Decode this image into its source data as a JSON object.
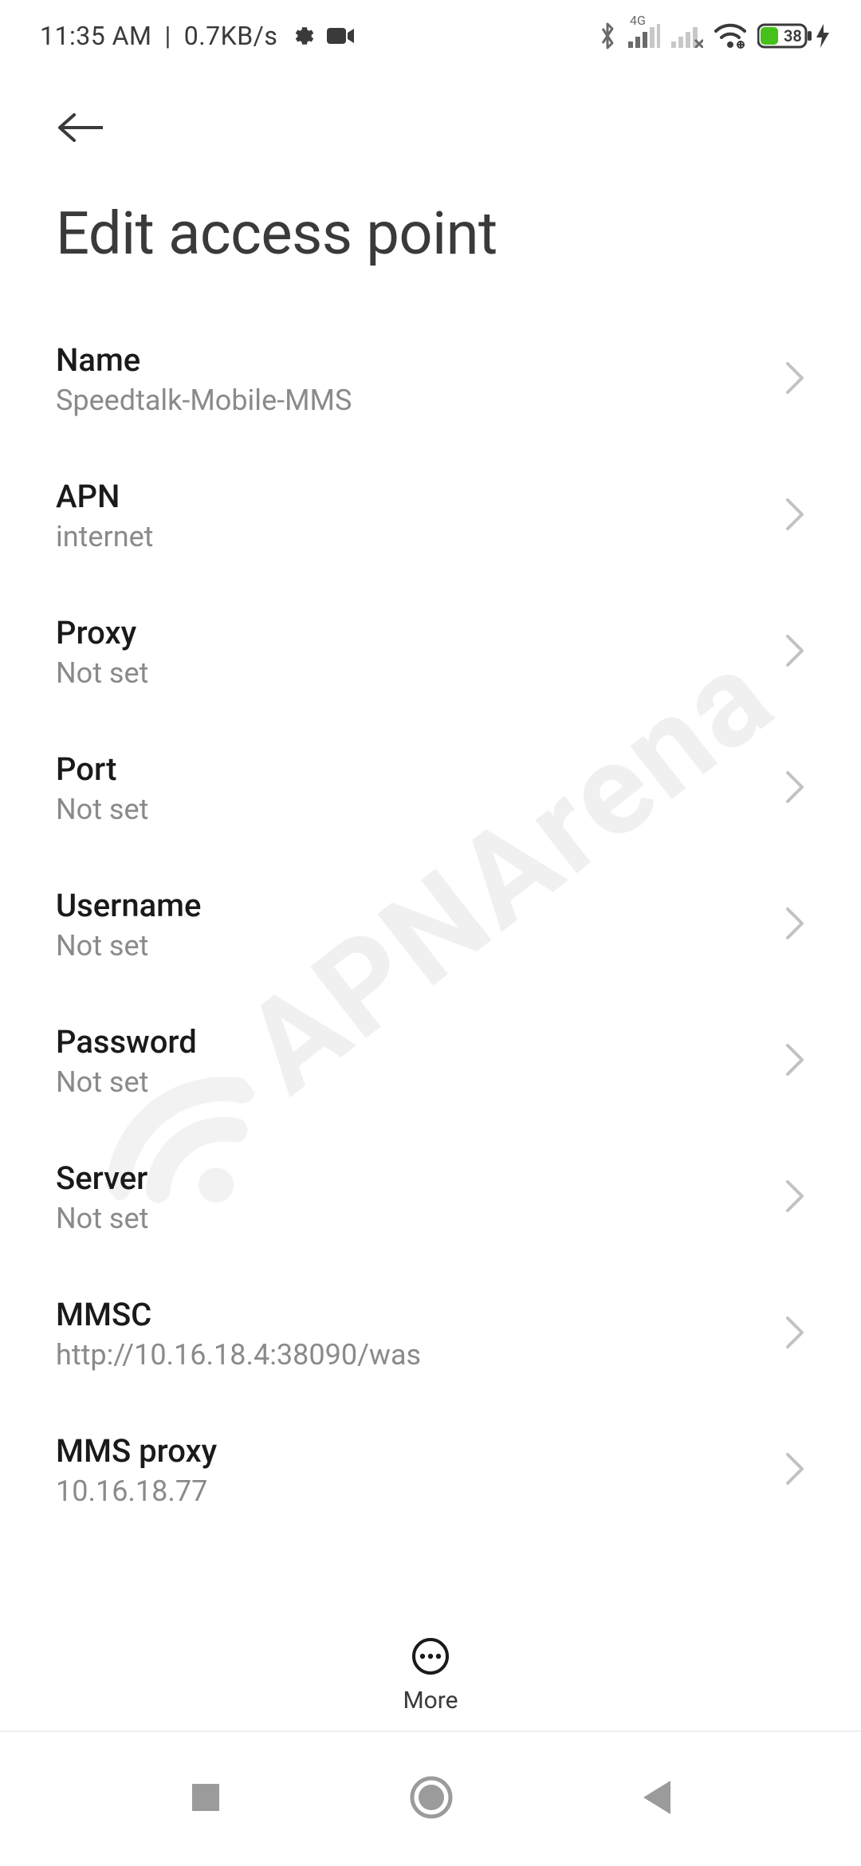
{
  "status": {
    "time": "11:35 AM",
    "sep": "|",
    "net_speed": "0.7KB/s",
    "battery_pct": "38",
    "signal_label": "4G"
  },
  "page": {
    "title": "Edit access point"
  },
  "settings": [
    {
      "title": "Name",
      "value": "Speedtalk-Mobile-MMS"
    },
    {
      "title": "APN",
      "value": "internet"
    },
    {
      "title": "Proxy",
      "value": "Not set"
    },
    {
      "title": "Port",
      "value": "Not set"
    },
    {
      "title": "Username",
      "value": "Not set"
    },
    {
      "title": "Password",
      "value": "Not set"
    },
    {
      "title": "Server",
      "value": "Not set"
    },
    {
      "title": "MMSC",
      "value": "http://10.16.18.4:38090/was"
    },
    {
      "title": "MMS proxy",
      "value": "10.16.18.77"
    }
  ],
  "more_label": "More",
  "watermark_text": "APNArena"
}
